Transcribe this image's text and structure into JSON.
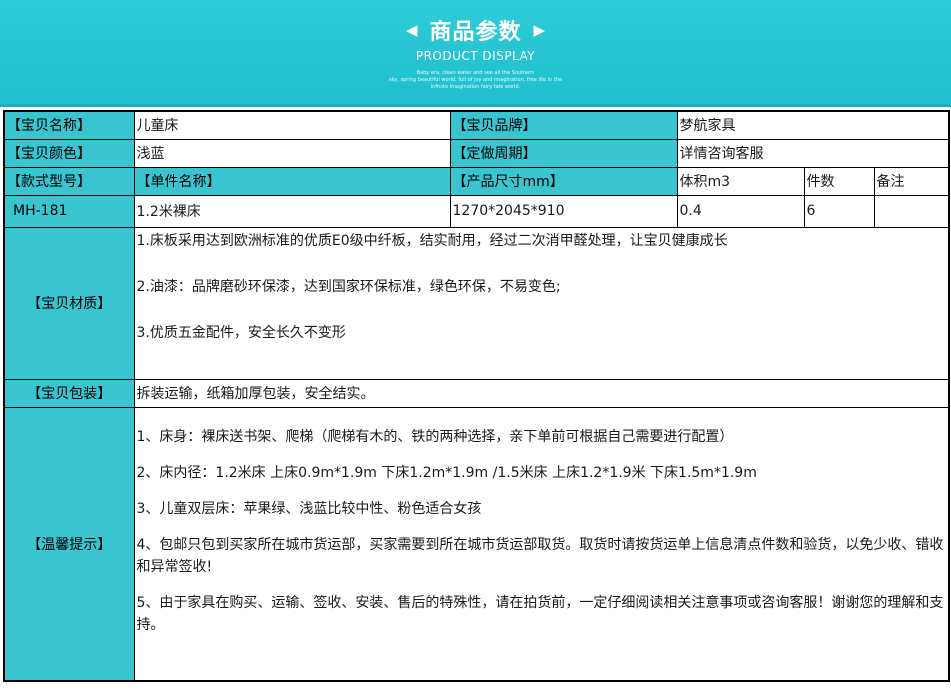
{
  "banner": {
    "title": "商品参数",
    "subtitle": "PRODUCT DISPLAY",
    "note_lines": [
      "Baby era, clean water and see all the Southern",
      "sky, spring beautiful world, full of joy and imagination, free life in the",
      "infinite imagination fairy tale world."
    ]
  },
  "table": {
    "row1": {
      "name_label": "【宝贝名称】",
      "name_value": "儿童床",
      "brand_label": "【宝贝品牌】",
      "brand_value": "梦航家具"
    },
    "row2": {
      "color_label": "【宝贝颜色】",
      "color_value": "浅蓝",
      "cycle_label": "【定做周期】",
      "cycle_value": "详情咨询客服"
    },
    "row3": {
      "model_label": "【款式型号】",
      "item_label": "【单件名称】",
      "size_label": "【产品尺寸mm】",
      "volume_label": "体积m3",
      "count_label": "件数",
      "remark_label": "备注"
    },
    "row4": {
      "model": "MH-181",
      "item": "1.2米裸床",
      "size": "1270*2045*910",
      "volume": "0.4",
      "count": "6",
      "remark": ""
    },
    "material": {
      "label": "【宝贝材质】",
      "lines": [
        "1.床板采用达到欧洲标准的优质E0级中纤板，结实耐用，经过二次消甲醛处理，让宝贝健康成长",
        "2.油漆：品牌磨砂环保漆，达到国家环保标准，绿色环保，不易变色;",
        "3.优质五金配件，安全长久不变形"
      ]
    },
    "package": {
      "label": "【宝贝包装】",
      "value": "拆装运输，纸箱加厚包装，安全结实。"
    },
    "tips": {
      "label": "【温馨提示】",
      "lines": [
        "1、床身：裸床送书架、爬梯（爬梯有木的、铁的两种选择，亲下单前可根据自己需要进行配置）",
        "2、床内径：1.2米床 上床0.9m*1.9m 下床1.2m*1.9m /1.5米床 上床1.2*1.9米 下床1.5m*1.9m",
        "3、儿童双层床：苹果绿、浅蓝比较中性、粉色适合女孩",
        "4、包邮只包到买家所在城市货运部，买家需要到所在城市货运部取货。取货时请按货运单上信息清点件数和验货，以免少收、错收和异常签收!",
        "5、由于家具在购买、运输、签收、安装、售后的特殊性，请在拍货前，一定仔细阅读相关注意事项或咨询客服！谢谢您的理解和支持。"
      ]
    }
  }
}
